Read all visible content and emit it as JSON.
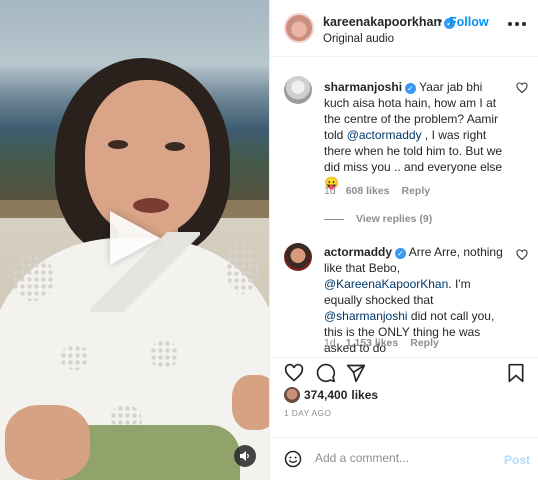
{
  "post": {
    "username": "kareenakapoorkhan",
    "follow_label": "Follow",
    "separator": "•",
    "audio_label": "Original audio"
  },
  "comments": [
    {
      "username": "sharmanjoshi",
      "text_1": "Yaar jab bhi kuch aisa hota hain, how am I at the centre of the problem? Aamir told ",
      "mention_1": "@actormaddy",
      "text_2": " , I was right there when he told him to. But we did miss you .. and everyone else ",
      "emoji": "😛",
      "time": "1d",
      "likes": "608 likes",
      "reply_label": "Reply"
    },
    {
      "username": "actormaddy",
      "text_1": "Arre Arre, nothing like that Bebo, ",
      "mention_1": "@KareenaKapoorKhan",
      "text_2": ". I'm equally shocked that ",
      "mention_2": "@sharmanjoshi",
      "text_3": " did not call you, this is the ONLY thing he was asked to do",
      "time": "1d",
      "likes": "1,153 likes",
      "reply_label": "Reply"
    }
  ],
  "view_replies": "View replies (9)",
  "likes_count": "374,400",
  "likes_suffix": "likes",
  "time_ago": "1 DAY AGO",
  "add_comment": {
    "placeholder": "Add a comment...",
    "post_label": "Post"
  },
  "colors": {
    "accent": "#0095f6",
    "verified": "#3897f0",
    "muted": "#8e8e8e"
  }
}
